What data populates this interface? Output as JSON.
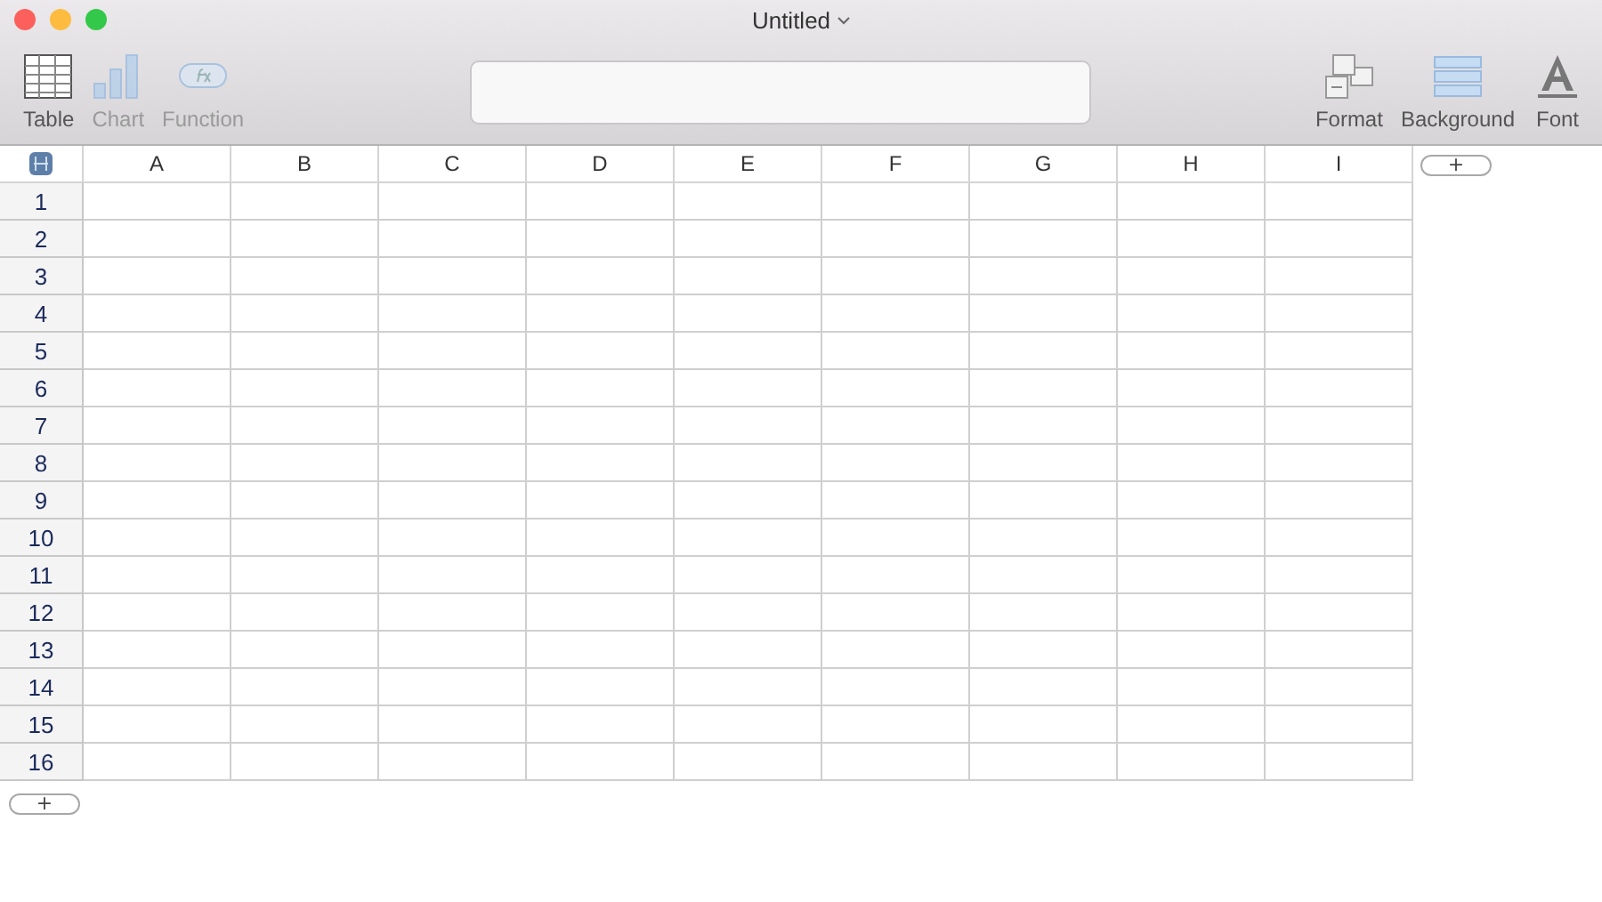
{
  "window": {
    "title": "Untitled"
  },
  "toolbar_left": [
    {
      "label": "Table",
      "kind": "table",
      "disabled": false
    },
    {
      "label": "Chart",
      "kind": "chart",
      "disabled": true
    },
    {
      "label": "Function",
      "kind": "function",
      "disabled": true
    }
  ],
  "toolbar_right": [
    {
      "label": "Format",
      "kind": "format",
      "disabled": false
    },
    {
      "label": "Background",
      "kind": "background",
      "disabled": false
    },
    {
      "label": "Font",
      "kind": "font",
      "disabled": false
    }
  ],
  "table": {
    "columns": [
      "A",
      "B",
      "C",
      "D",
      "E",
      "F",
      "G",
      "H",
      "I"
    ],
    "rows": [
      "1",
      "2",
      "3",
      "4",
      "5",
      "6",
      "7",
      "8",
      "9",
      "10",
      "11",
      "12",
      "13",
      "14",
      "15",
      "16"
    ],
    "add_column": "+",
    "add_row": "+"
  }
}
